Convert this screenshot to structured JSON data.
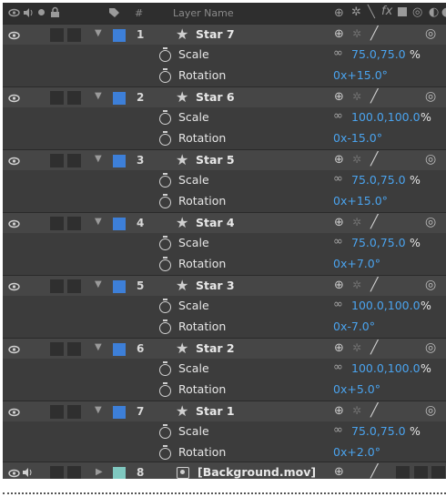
{
  "header": {
    "hash": "#",
    "layer_name": "Layer Name"
  },
  "colors": {
    "label_blue": "#3d7fd8",
    "label_teal": "#7fc8c0",
    "value_blue": "#4aa3ee"
  },
  "layers": [
    {
      "num": "1",
      "name": "Star 7",
      "scale": "75.0,75.0",
      "rotation": "0x+15.0°"
    },
    {
      "num": "2",
      "name": "Star 6",
      "scale": "100.0,100.0",
      "rotation": "0x-15.0°"
    },
    {
      "num": "3",
      "name": "Star 5",
      "scale": "75.0,75.0",
      "rotation": "0x+15.0°"
    },
    {
      "num": "4",
      "name": "Star 4",
      "scale": "75.0,75.0",
      "rotation": "0x+7.0°"
    },
    {
      "num": "5",
      "name": "Star 3",
      "scale": "100.0,100.0",
      "rotation": "0x-7.0°"
    },
    {
      "num": "6",
      "name": "Star 2",
      "scale": "100.0,100.0",
      "rotation": "0x+5.0°"
    },
    {
      "num": "7",
      "name": "Star 1",
      "scale": "75.0,75.0",
      "rotation": "0x+2.0°"
    }
  ],
  "property_labels": {
    "scale": "Scale",
    "rotation": "Rotation",
    "percent": "%"
  },
  "background_layer": {
    "num": "8",
    "name": "[Background.mov]"
  },
  "icons": {
    "visibility": "eye-icon",
    "audio": "speaker-icon",
    "solo": "solo-dot-icon",
    "lock": "lock-icon",
    "label": "tag-icon",
    "stopwatch": "stopwatch-icon",
    "constrain": "link-icon",
    "shy": "shy-icon",
    "star_layer": "star-icon",
    "footage": "footage-icon"
  }
}
